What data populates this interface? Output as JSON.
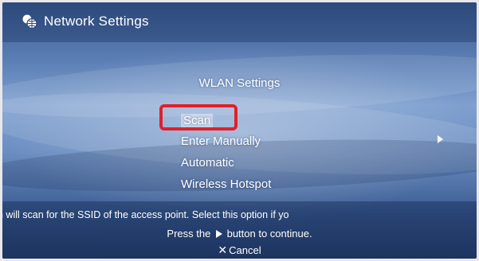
{
  "header": {
    "icon": "network-globe-icon",
    "title": "Network Settings"
  },
  "section": {
    "title": "WLAN Settings"
  },
  "menu": {
    "selected_index": 0,
    "items": [
      {
        "label": "Scan"
      },
      {
        "label": "Enter Manually"
      },
      {
        "label": "Automatic"
      },
      {
        "label": "Wireless Hotspot"
      }
    ],
    "submenu_icon": "right-arrow-icon"
  },
  "annotation": {
    "highlight_color": "#e0202a"
  },
  "hints": {
    "description": "n will scan for the SSID of the access point. Select this option if yo",
    "continue_prefix": "Press the",
    "continue_icon": "play-button-icon",
    "continue_suffix": "button to continue.",
    "cancel_icon": "cross-button-icon",
    "cancel_glyph": "✕",
    "cancel_label": "Cancel"
  },
  "colors": {
    "background_top": "#3f5d8f",
    "background_mid": "#7fa0cf",
    "background_bottom": "#2c4a80",
    "text": "#ffffff"
  }
}
